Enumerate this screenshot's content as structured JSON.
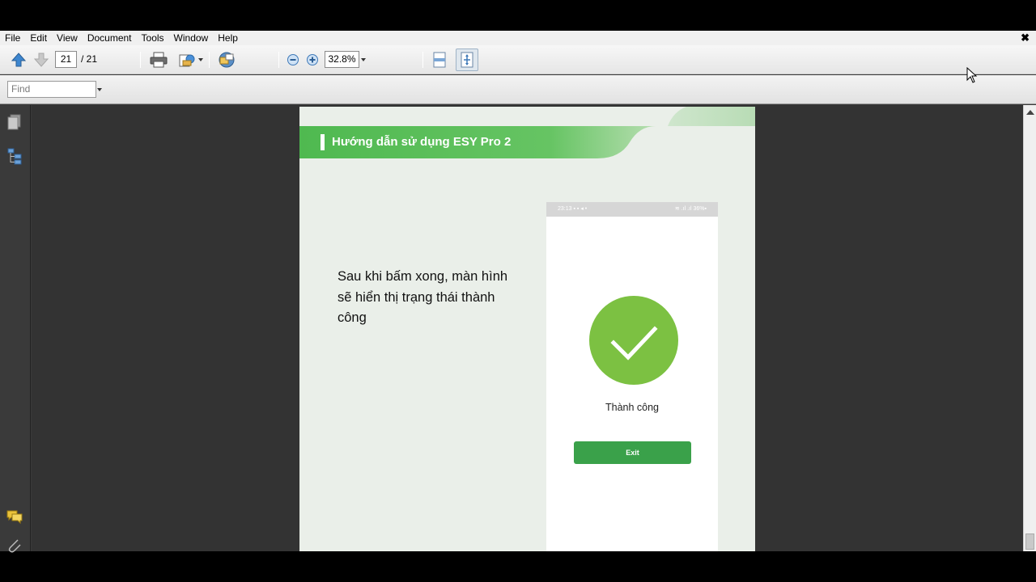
{
  "menu": {
    "items": [
      "File",
      "Edit",
      "View",
      "Document",
      "Tools",
      "Window",
      "Help"
    ],
    "close_glyph": "✖"
  },
  "toolbar": {
    "current_page": "21",
    "page_separator": "/ 21",
    "zoom": "32.8%",
    "icons": [
      "up-arrow-icon",
      "down-arrow-icon",
      "printer-icon",
      "share-icon",
      "collaborate-icon",
      "zoom-out-icon",
      "zoom-in-icon",
      "fit-width-icon",
      "fit-page-icon"
    ]
  },
  "find": {
    "placeholder": "Find"
  },
  "document": {
    "banner_title": "Hướng dẫn sử dụng ESY Pro 2",
    "body_text": "Sau khi bấm xong, màn hình sẽ hiển thị trạng thái thành công",
    "phone": {
      "status_left": "23:13 ▪ ▪ ◂ •",
      "status_right": "≋ .ıl .ıl 36%▪",
      "success_label": "Thành công",
      "exit_button": "Exit"
    }
  },
  "colors": {
    "banner_green": "#5cbf5a",
    "check_green": "#7cc142",
    "button_green": "#3aa14a",
    "page_bg": "#eaefe9"
  }
}
